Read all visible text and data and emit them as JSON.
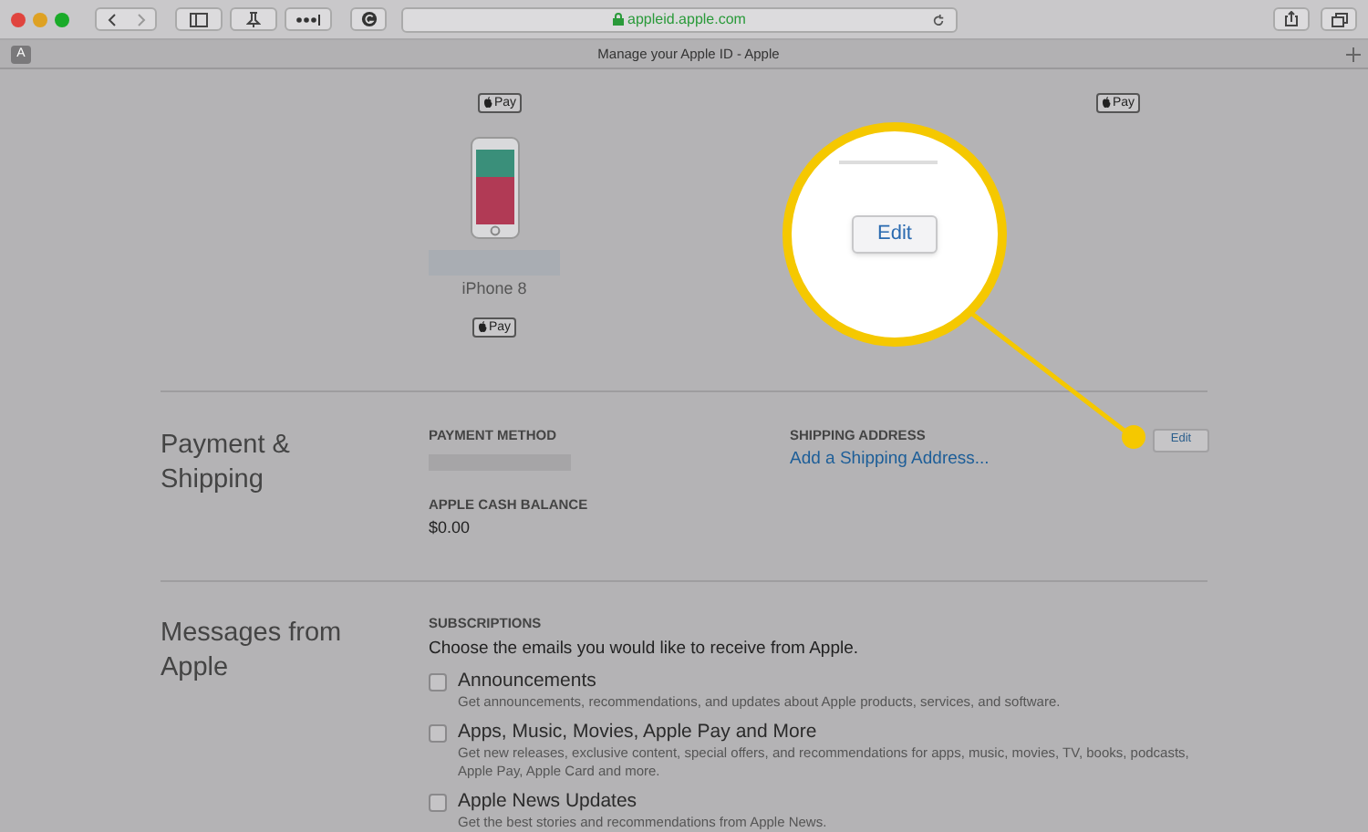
{
  "browser": {
    "url": "appleid.apple.com",
    "tab_badge": "A",
    "tab_title": "Manage your Apple ID - Apple"
  },
  "devices": {
    "top_badges": [
      "Pay",
      "Pay"
    ],
    "device": {
      "name": "iPhone 8",
      "badge": "Pay"
    }
  },
  "magnifier": {
    "button": "Edit"
  },
  "payment": {
    "heading": "Payment & Shipping",
    "payment_method_label": "PAYMENT METHOD",
    "cash_label": "APPLE CASH BALANCE",
    "cash_value": "$0.00",
    "shipping_label": "SHIPPING ADDRESS",
    "shipping_link": "Add a Shipping Address...",
    "edit_button": "Edit"
  },
  "messages": {
    "heading": "Messages from Apple",
    "subscriptions_label": "SUBSCRIPTIONS",
    "intro": "Choose the emails you would like to receive from Apple.",
    "options": [
      {
        "title": "Announcements",
        "description": "Get announcements, recommendations, and updates about Apple products, services, and software.",
        "checked": false
      },
      {
        "title": "Apps, Music, Movies, Apple Pay and More",
        "description": "Get new releases, exclusive content, special offers, and recommendations for apps, music, movies, TV, books, podcasts, Apple Pay, Apple Card and more.",
        "checked": false
      },
      {
        "title": "Apple News Updates",
        "description": "Get the best stories and recommendations from Apple News.",
        "checked": false
      }
    ]
  }
}
